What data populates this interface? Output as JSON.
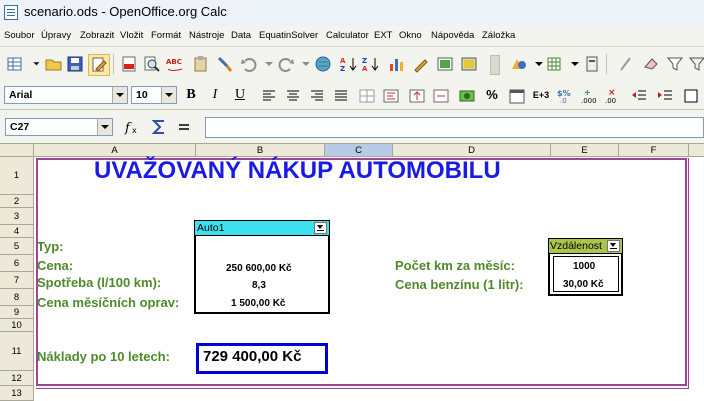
{
  "window": {
    "title": "scenario.ods - OpenOffice.org Calc"
  },
  "menu": [
    "Soubor",
    "Úpravy",
    "Zobrazit",
    "Vložit",
    "Formát",
    "Nástroje",
    "Data",
    "EquatinSolver",
    "Calculator",
    "EXT",
    "Okno",
    "Nápověda",
    "Záložka"
  ],
  "formatting": {
    "font": "Arial",
    "size": "10"
  },
  "formula_bar": {
    "cell_ref": "C27",
    "content": ""
  },
  "columns": [
    "A",
    "B",
    "C",
    "D",
    "E",
    "F"
  ],
  "selected_column": "C",
  "rows": [
    "1",
    "2",
    "3",
    "4",
    "5",
    "6",
    "7",
    "8",
    "9",
    "10",
    "11",
    "12",
    "13"
  ],
  "sheet": {
    "heading": "UVAŽOVANÝ NÁKUP AUTOMOBILU",
    "labels": {
      "typ": "Typ:",
      "cena": "Cena:",
      "spotreba": "Spotřeba (l/100 km):",
      "opravy": "Cena měsíčních oprav:",
      "km": "Počet km za měsíc:",
      "benzin": "Cena benzínu (1 litr):",
      "naklady": "Náklady po 10 letech:"
    },
    "scenario_auto": {
      "name": "Auto1",
      "cena": "250 600,00 Kč",
      "spotreba": "8,3",
      "opravy": "1 500,00 Kč"
    },
    "scenario_vzdalenost": {
      "name": "Vzdálenost",
      "km": "1000",
      "benzin": "30,00 Kč"
    },
    "total": "729 400,00 Kč"
  },
  "colors": {
    "label_green": "#4e8a2c",
    "heading_blue": "#1a1ae6",
    "scenario_cyan": "#3fe0ee",
    "scenario_green": "#a9c64a",
    "print_border": "#a0449a"
  }
}
